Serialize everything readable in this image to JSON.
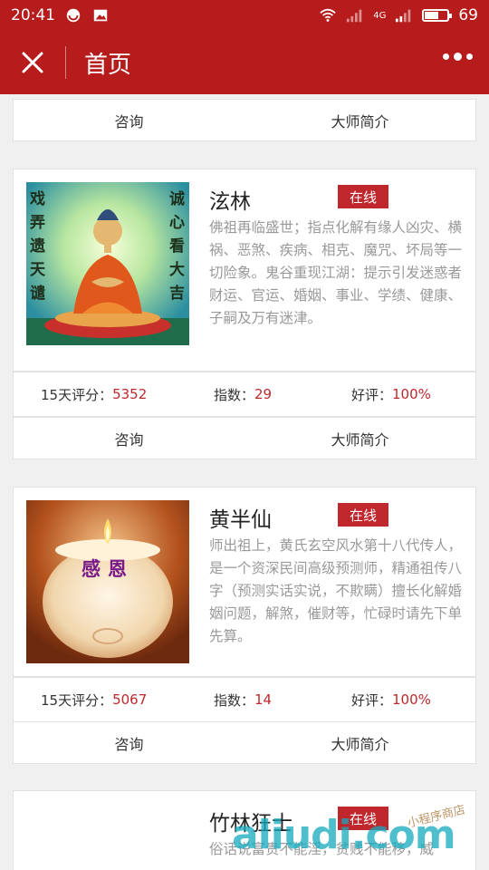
{
  "status_bar": {
    "time": "20:41",
    "network": "4G",
    "battery": "69",
    "battery_level": 0.69,
    "icons": [
      "ring-notification-icon",
      "image-notification-icon",
      "wifi-icon",
      "signal-icon"
    ]
  },
  "nav": {
    "title": "首页",
    "close_icon": "close-icon",
    "more_icon": "more-dots-icon"
  },
  "actions": {
    "consult": "咨询",
    "profile": "大师简介"
  },
  "masters": [
    {
      "name": "泫林",
      "status": "在线",
      "image": {
        "left_text": "戏弄遗天谴",
        "right_text": "诚心看大吉"
      },
      "description": "佛祖再临盛世；指点化解有缘人凶灾、横祸、恶煞、疾病、相克、魔咒、坏局等一切险象。鬼谷重现江湖：提示引发迷惑者财运、官运、婚姻、事业、学绩、健康、子嗣及万有迷津。",
      "rating_label": "15天评分：",
      "rating": "5352",
      "index_label": "指数：",
      "index": "29",
      "praise_label": "好评：",
      "praise": "100%"
    },
    {
      "name": "黄半仙",
      "status": "在线",
      "image": {
        "candle_text": "感恩"
      },
      "description": "师出祖上，黄氏玄空风水第十八代传人，是一个资深民间高级预测师，精通祖传八字（预测实话实说，不欺瞒）擅长化解婚姻问题，解煞，催财等，忙碌时请先下单先算。",
      "rating_label": "15天评分：",
      "rating": "5067",
      "index_label": "指数：",
      "index": "14",
      "praise_label": "好评：",
      "praise": "100%"
    },
    {
      "name": "竹林狂士",
      "status": "在线",
      "description": "俗话说富贵不能淫，贫贱不能移，威"
    }
  ],
  "watermark": {
    "text": "aliudi.com",
    "subtext": "小程序商店"
  }
}
